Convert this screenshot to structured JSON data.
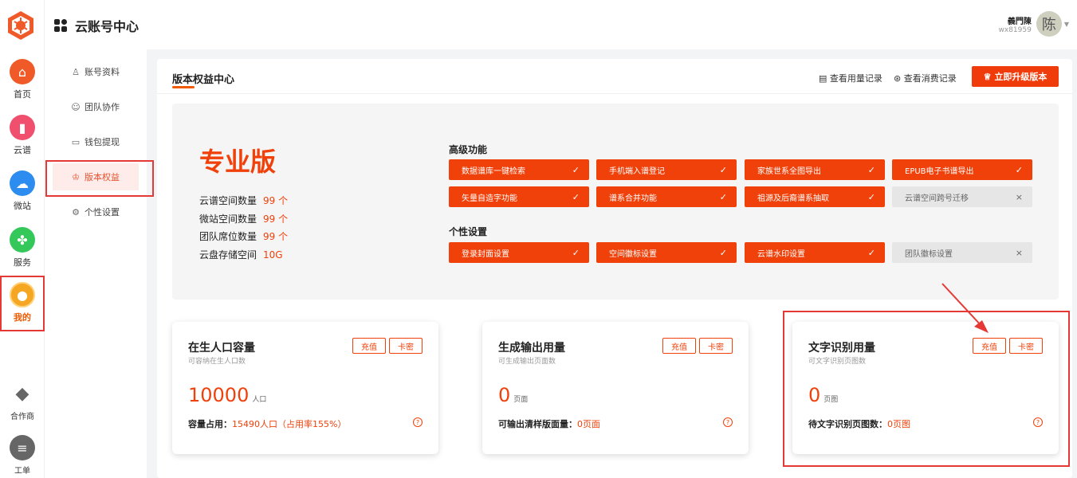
{
  "rail": {
    "items": [
      {
        "label": "首页",
        "icon": "home-icon",
        "color": "#f05a28"
      },
      {
        "label": "云谱",
        "icon": "book-icon",
        "color": "#f0506e"
      },
      {
        "label": "微站",
        "icon": "cloud-icon",
        "color": "#2d8cf0"
      },
      {
        "label": "服务",
        "icon": "clover-icon",
        "color": "#34c759"
      },
      {
        "label": "我的",
        "icon": "user-icon",
        "color": "#f5a623"
      },
      {
        "label": "合作商",
        "icon": "handshake-icon",
        "color": "#666666"
      },
      {
        "label": "工单",
        "icon": "chat-icon",
        "color": "#666666"
      }
    ]
  },
  "sidebar": {
    "items": [
      {
        "label": "账号资料",
        "icon": "user-outline-icon"
      },
      {
        "label": "团队协作",
        "icon": "team-icon"
      },
      {
        "label": "钱包提现",
        "icon": "wallet-icon"
      },
      {
        "label": "版本权益",
        "icon": "badge-icon"
      },
      {
        "label": "个性设置",
        "icon": "settings-icon"
      }
    ]
  },
  "header": {
    "title": "云账号中心",
    "user_name": "義門陳",
    "user_id": "wx81959",
    "avatar_char": "陈"
  },
  "main": {
    "title": "版本权益中心",
    "usage_link": "查看用量记录",
    "consume_link": "查看消费记录",
    "upgrade_label": "立即升级版本"
  },
  "plan": {
    "name": "专业版",
    "stats": [
      {
        "label": "云谱空间数量",
        "value": "99 个"
      },
      {
        "label": "微站空间数量",
        "value": "99 个"
      },
      {
        "label": "团队席位数量",
        "value": "99 个"
      },
      {
        "label": "云盘存储空间",
        "value": "10G"
      }
    ],
    "advanced_title": "高级功能",
    "advanced": [
      {
        "label": "数据谱库一键检索",
        "on": true
      },
      {
        "label": "手机端入谱登记",
        "on": true
      },
      {
        "label": "家族世系全图导出",
        "on": true
      },
      {
        "label": "EPUB电子书谱导出",
        "on": true
      },
      {
        "label": "矢量自造字功能",
        "on": true
      },
      {
        "label": "谱系合并功能",
        "on": true
      },
      {
        "label": "祖源及后裔谱系抽取",
        "on": true
      },
      {
        "label": "云谱空间跨号迁移",
        "on": false
      }
    ],
    "personal_title": "个性设置",
    "personal": [
      {
        "label": "登录封面设置",
        "on": true
      },
      {
        "label": "空间徽标设置",
        "on": true
      },
      {
        "label": "云谱水印设置",
        "on": true
      },
      {
        "label": "团队徽标设置",
        "on": false
      }
    ],
    "check_mark": "✓",
    "cross_mark": "×"
  },
  "cards": [
    {
      "title": "在生人口容量",
      "sub": "可容纳在生人口数",
      "recharge": "充值",
      "card": "卡密",
      "num": "10000",
      "unit": "人口",
      "foot_label": "容量占用：",
      "foot_value": "15490人口（占用率155%）"
    },
    {
      "title": "生成输出用量",
      "sub": "可生成输出页面数",
      "recharge": "充值",
      "card": "卡密",
      "num": "0",
      "unit": "页面",
      "foot_label": "可输出清样版面量：",
      "foot_value": "0页面"
    },
    {
      "title": "文字识别用量",
      "sub": "可文字识别页图数",
      "recharge": "充值",
      "card": "卡密",
      "num": "0",
      "unit": "页图",
      "foot_label": "待文字识别页图数：",
      "foot_value": "0页图"
    }
  ],
  "help_mark": "?"
}
